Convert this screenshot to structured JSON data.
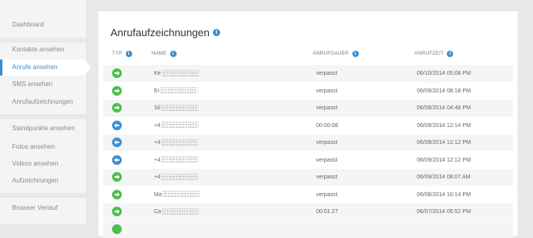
{
  "sidebar": {
    "items": [
      {
        "label": "Dashboard"
      },
      {
        "label": "Kontakte ansehen"
      },
      {
        "label": "Anrufe ansehen"
      },
      {
        "label": "SMS ansehen"
      },
      {
        "label": "Anrufaufzeichnungen"
      },
      {
        "label": "Standpunkte ansehen"
      },
      {
        "label": "Fotos ansehen"
      },
      {
        "label": "Videos ansehen"
      },
      {
        "label": "Aufzeichnungen"
      },
      {
        "label": "Browser Verlauf"
      }
    ],
    "active_index": 2,
    "accent_color": "#3b8fd0"
  },
  "main": {
    "title": "Anrufaufzeichnungen",
    "title_icon": "info-icon",
    "columns": {
      "type": "TYP",
      "name": "NAME",
      "duration": "ANRUFDAUER",
      "time": "ANRUFZEIT"
    },
    "rows": [
      {
        "type": "outgoing",
        "name": "Ke",
        "duration": "verpasst",
        "time": "06/10/2014 05:08 PM"
      },
      {
        "type": "outgoing",
        "name": "Er",
        "duration": "verpasst",
        "time": "06/09/2014 08:18 PM"
      },
      {
        "type": "outgoing",
        "name": "Sil",
        "duration": "verpasst",
        "time": "06/09/2014 04:48 PM"
      },
      {
        "type": "incoming",
        "name": "+4",
        "duration": "00:00:08",
        "time": "06/09/2014 12:14 PM"
      },
      {
        "type": "incoming",
        "name": "+4",
        "duration": "verpasst",
        "time": "06/09/2014 12:12 PM"
      },
      {
        "type": "incoming",
        "name": "+4",
        "duration": "verpasst",
        "time": "06/09/2014 12:12 PM"
      },
      {
        "type": "outgoing",
        "name": "+4",
        "duration": "verpasst",
        "time": "06/09/2014 08:07 AM"
      },
      {
        "type": "outgoing",
        "name": "Ma",
        "duration": "verpasst",
        "time": "06/08/2014 10:14 PM"
      },
      {
        "type": "outgoing",
        "name": "Ca",
        "duration": "00:01:27",
        "time": "06/07/2014 06:52 PM"
      }
    ],
    "outgoing_color": "#4cbf4c",
    "incoming_color": "#3b8fd0"
  }
}
